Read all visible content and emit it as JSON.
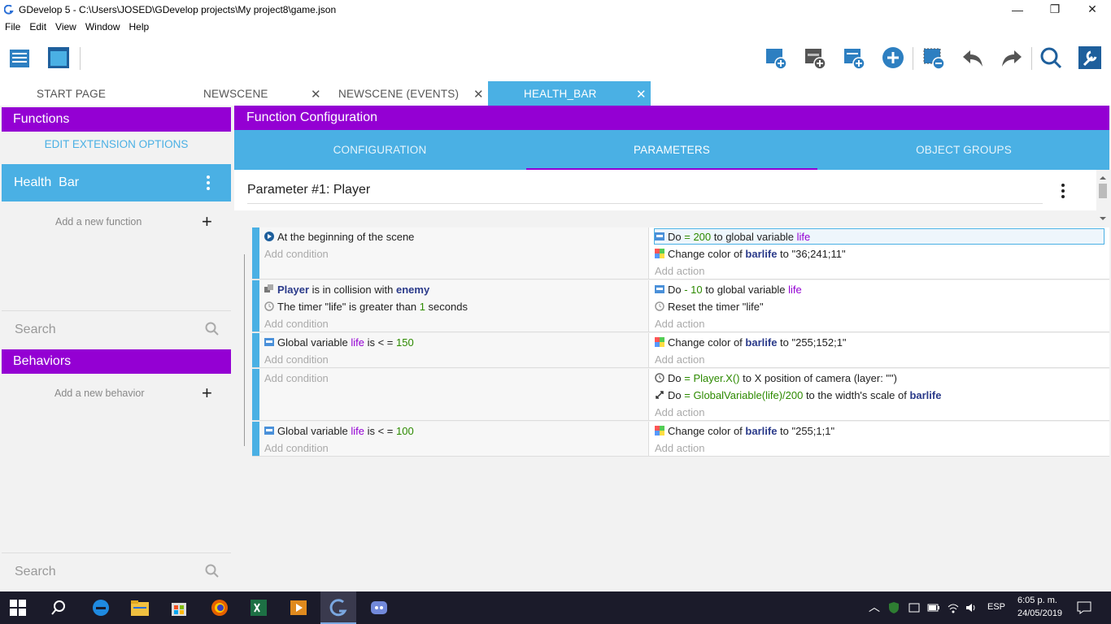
{
  "window": {
    "title": "GDevelop 5 - C:\\Users\\JOSED\\GDevelop projects\\My project8\\game.json",
    "minimize": "—",
    "maximize": "❐",
    "close": "✕"
  },
  "menu": [
    "File",
    "Edit",
    "View",
    "Window",
    "Help"
  ],
  "tabs": [
    {
      "label": "START PAGE",
      "closable": false
    },
    {
      "label": "NEWSCENE",
      "closable": true
    },
    {
      "label": "NEWSCENE (EVENTS)",
      "closable": true
    },
    {
      "label": "HEALTH_BAR",
      "closable": true,
      "active": true
    }
  ],
  "tab_close": "✕",
  "functions_panel": {
    "header": "Functions",
    "edit_extension": "EDIT EXTENSION OPTIONS",
    "items": [
      {
        "label": "Health  Bar"
      }
    ],
    "add_function": "Add a new function",
    "search_placeholder": "Search"
  },
  "behaviors_panel": {
    "header": "Behaviors",
    "add_behavior": "Add a new behavior",
    "search_placeholder": "Search"
  },
  "plus": "+",
  "main": {
    "header": "Function Configuration",
    "subtabs": [
      "CONFIGURATION",
      "PARAMETERS",
      "OBJECT GROUPS"
    ],
    "active_subtab": "PARAMETERS",
    "parameter_label": "Parameter #1: Player"
  },
  "events": [
    {
      "conditions": [
        {
          "parts": [
            [
              "t",
              "At the beginning of the scene"
            ]
          ],
          "icon": "scene-start-icon"
        }
      ],
      "add_condition": "Add condition",
      "actions": [
        {
          "parts": [
            [
              "t",
              "Do "
            ],
            [
              "n",
              "= 200"
            ],
            [
              "t",
              " to global variable "
            ],
            [
              "v",
              "life"
            ]
          ],
          "icon": "variable-icon",
          "selected": true
        },
        {
          "parts": [
            [
              "t",
              "Change color of "
            ],
            [
              "o",
              "barlife"
            ],
            [
              "t",
              " to \"36;241;11\""
            ]
          ],
          "icon": "color-icon"
        }
      ],
      "add_action": "Add action"
    },
    {
      "conditions": [
        {
          "parts": [
            [
              "o",
              "Player"
            ],
            [
              "t",
              " is in collision with "
            ],
            [
              "o",
              "enemy"
            ]
          ],
          "icon": "collision-icon"
        },
        {
          "parts": [
            [
              "t",
              "The timer \"life\" is greater than "
            ],
            [
              "n",
              "1"
            ],
            [
              "t",
              " seconds"
            ]
          ],
          "icon": "timer-icon"
        }
      ],
      "add_condition": "Add condition",
      "actions": [
        {
          "parts": [
            [
              "t",
              "Do "
            ],
            [
              "n",
              "- 10"
            ],
            [
              "t",
              " to global variable "
            ],
            [
              "v",
              "life"
            ]
          ],
          "icon": "variable-icon"
        },
        {
          "parts": [
            [
              "t",
              "Reset the timer \"life\""
            ]
          ],
          "icon": "timer-icon"
        }
      ],
      "add_action": "Add action"
    },
    {
      "conditions": [
        {
          "parts": [
            [
              "t",
              "Global variable "
            ],
            [
              "v",
              "life"
            ],
            [
              "t",
              " is "
            ],
            [
              "t",
              "< ="
            ],
            [
              "n",
              " 150"
            ]
          ],
          "icon": "variable-icon"
        }
      ],
      "add_condition": "Add condition",
      "actions": [
        {
          "parts": [
            [
              "t",
              "Change color of "
            ],
            [
              "o",
              "barlife"
            ],
            [
              "t",
              " to \"255;152;1\""
            ]
          ],
          "icon": "color-icon"
        }
      ],
      "add_action": "Add action"
    },
    {
      "conditions": [],
      "add_condition": "Add condition",
      "actions": [
        {
          "parts": [
            [
              "t",
              "Do "
            ],
            [
              "n",
              "= Player.X()"
            ],
            [
              "t",
              " to X position of camera (layer: \"\")"
            ]
          ],
          "icon": "camera-icon"
        },
        {
          "parts": [
            [
              "t",
              "Do "
            ],
            [
              "n",
              "= GlobalVariable(life)/200"
            ],
            [
              "t",
              " to the width's scale of "
            ],
            [
              "o",
              "barlife"
            ]
          ],
          "icon": "scale-icon"
        }
      ],
      "add_action": "Add action"
    },
    {
      "conditions": [
        {
          "parts": [
            [
              "t",
              "Global variable "
            ],
            [
              "v",
              "life"
            ],
            [
              "t",
              " is "
            ],
            [
              "t",
              "< ="
            ],
            [
              "n",
              " 100"
            ]
          ],
          "icon": "variable-icon"
        }
      ],
      "add_condition": "Add condition",
      "actions": [
        {
          "parts": [
            [
              "t",
              "Change color of "
            ],
            [
              "o",
              "barlife"
            ],
            [
              "t",
              " to \"255;1;1\""
            ]
          ],
          "icon": "color-icon"
        }
      ],
      "add_action": "Add action"
    }
  ],
  "taskbar": {
    "language": "ESP",
    "time": "6:05 p. m.",
    "date": "24/05/2019"
  },
  "colors": {
    "accent_purple": "#9400d3",
    "accent_blue": "#4ab0e4"
  }
}
